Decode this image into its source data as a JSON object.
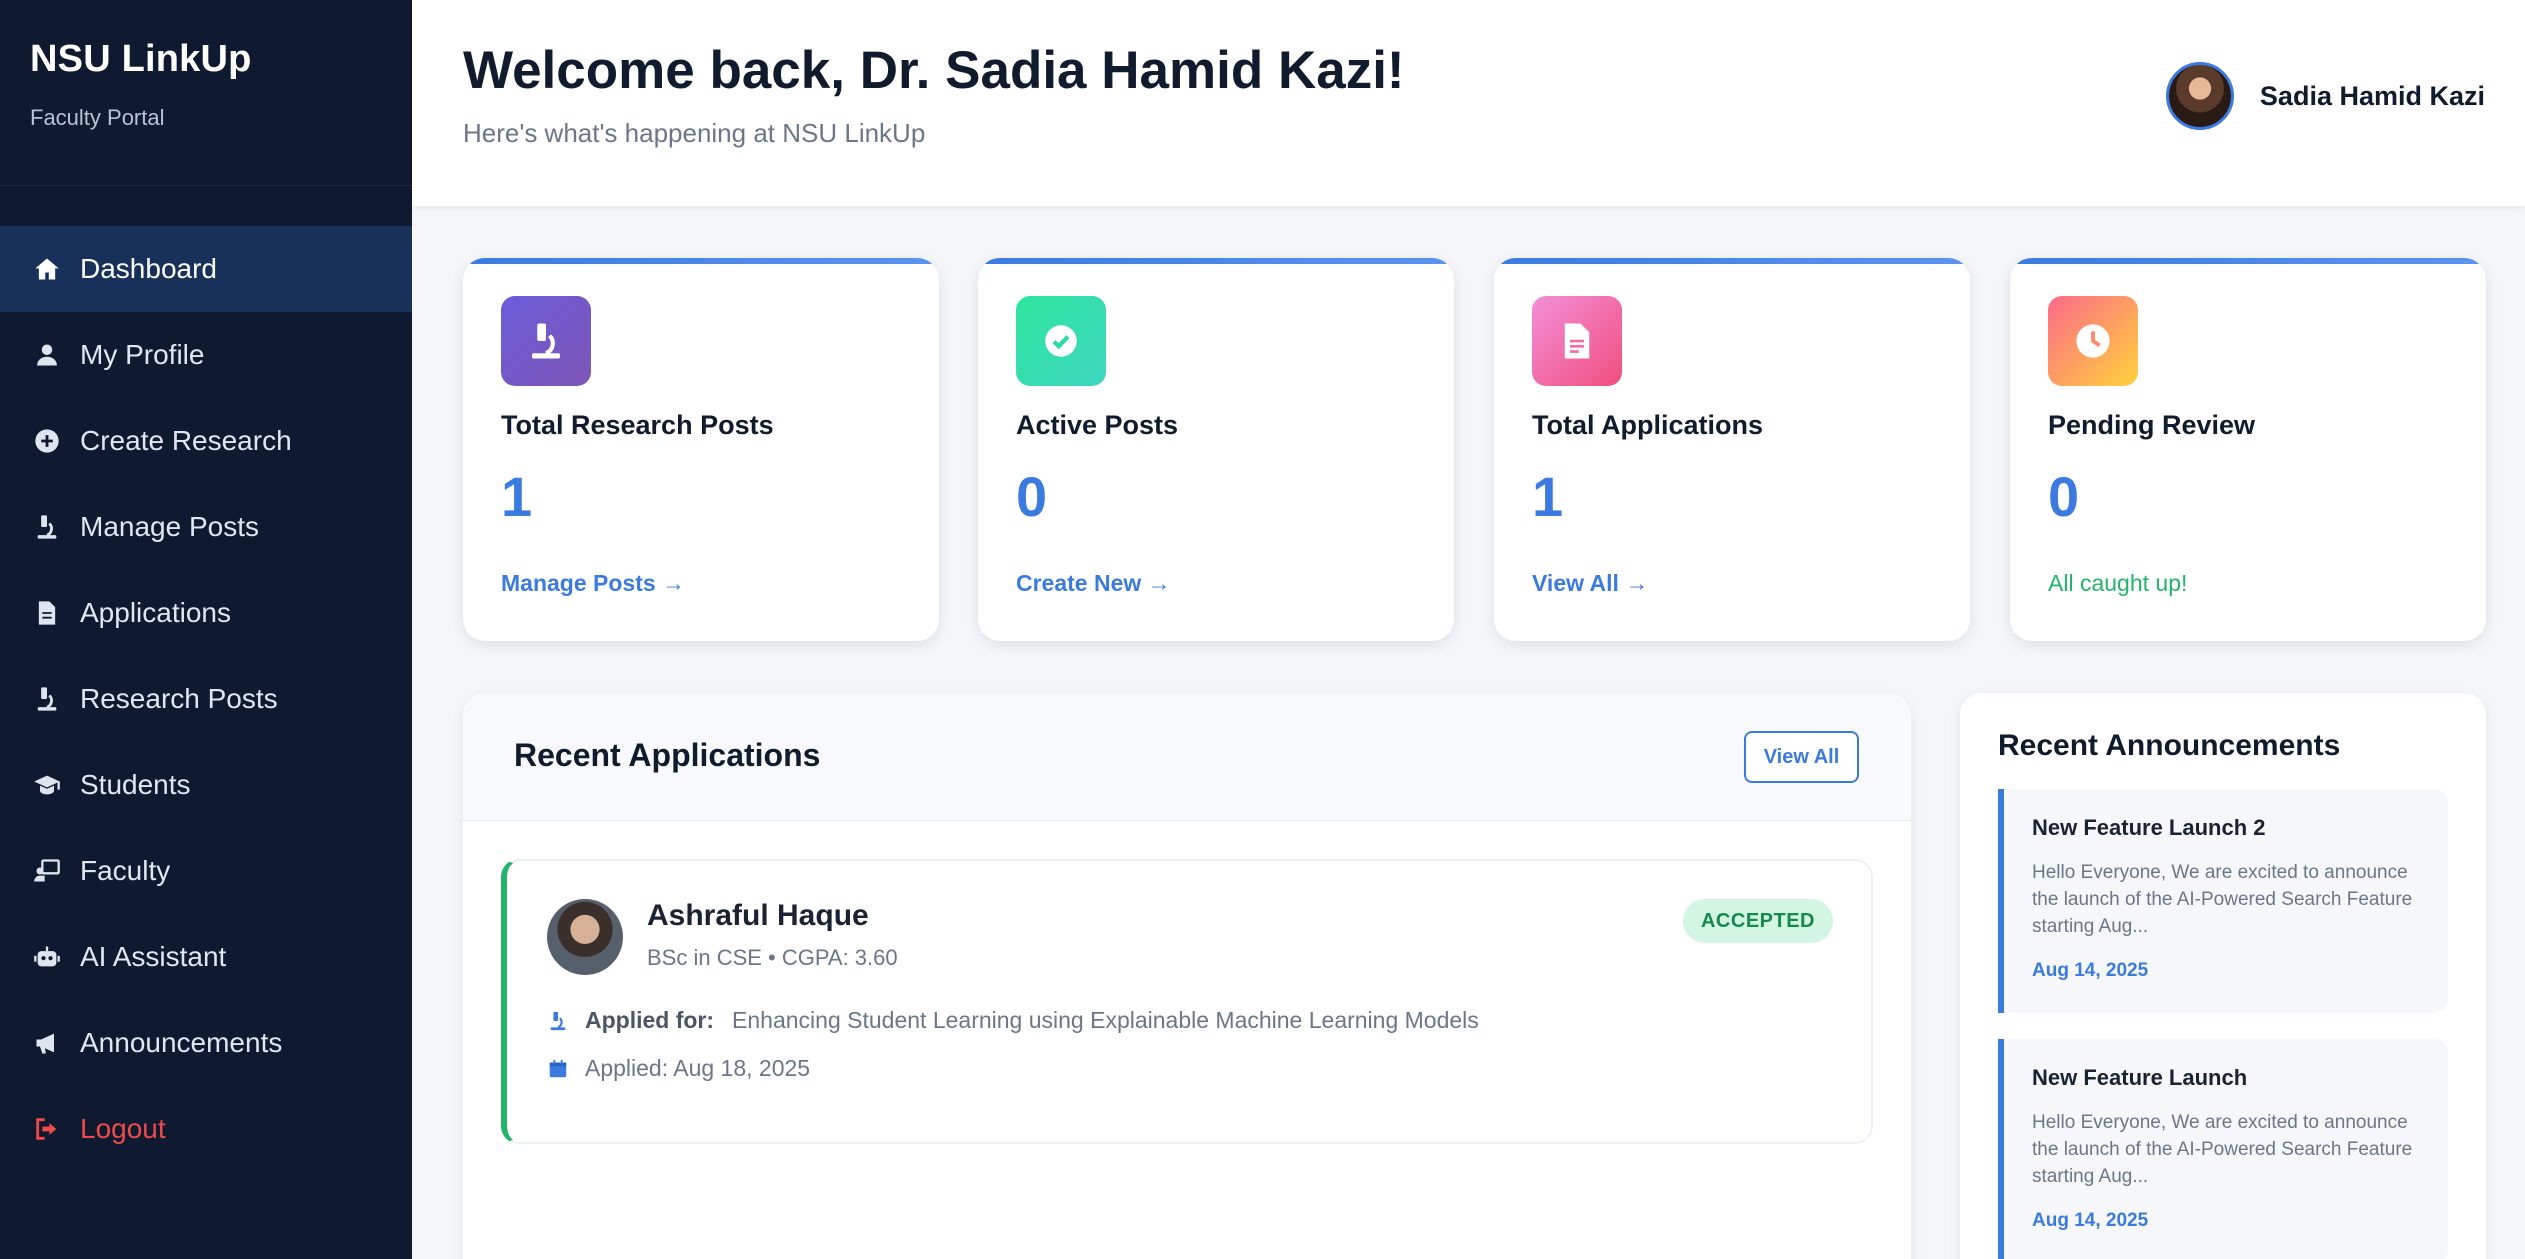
{
  "sidebar": {
    "brand_title": "NSU LinkUp",
    "brand_sub": "Faculty Portal",
    "items": [
      {
        "label": "Dashboard",
        "icon": "home-icon"
      },
      {
        "label": "My Profile",
        "icon": "user-icon"
      },
      {
        "label": "Create Research",
        "icon": "plus-circle-icon"
      },
      {
        "label": "Manage Posts",
        "icon": "microscope-icon"
      },
      {
        "label": "Applications",
        "icon": "document-icon"
      },
      {
        "label": "Research Posts",
        "icon": "microscope-icon"
      },
      {
        "label": "Students",
        "icon": "graduation-cap-icon"
      },
      {
        "label": "Faculty",
        "icon": "teacher-icon"
      },
      {
        "label": "AI Assistant",
        "icon": "robot-icon"
      },
      {
        "label": "Announcements",
        "icon": "megaphone-icon"
      },
      {
        "label": "Logout",
        "icon": "logout-icon"
      }
    ]
  },
  "header": {
    "welcome": "Welcome back, Dr. Sadia Hamid Kazi!",
    "subtitle": "Here's what's happening at NSU LinkUp",
    "user_name": "Sadia Hamid Kazi"
  },
  "stats": [
    {
      "label": "Total Research Posts",
      "value": "1",
      "link": "Manage Posts →",
      "icon": "microscope-icon",
      "color_from": "#6a5cd8",
      "color_to": "#7e55b7"
    },
    {
      "label": "Active Posts",
      "value": "0",
      "link": "Create New →",
      "icon": "check-circle-icon",
      "color_from": "#2ee59d",
      "color_to": "#3ed6c0"
    },
    {
      "label": "Total Applications",
      "value": "1",
      "link": "View All →",
      "icon": "document-icon",
      "color_from": "#f38fd8",
      "color_to": "#f04e7d"
    },
    {
      "label": "Pending Review",
      "value": "0",
      "link": "All caught up!",
      "icon": "clock-icon",
      "color_from": "#fb6a8a",
      "color_to": "#fed23a"
    }
  ],
  "recent_apps": {
    "title": "Recent Applications",
    "view_all": "View All",
    "items": [
      {
        "name": "Ashraful Haque",
        "meta": "BSc in CSE • CGPA: 3.60",
        "status": "ACCEPTED",
        "applied_for_label": "Applied for:",
        "applied_for": "Enhancing Student Learning using Explainable Machine Learning Models",
        "applied_date": "Applied: Aug 18, 2025"
      }
    ]
  },
  "announcements": {
    "title": "Recent Announcements",
    "items": [
      {
        "title": "New Feature Launch 2",
        "body": "Hello Everyone, We are excited to announce the launch of the AI-Powered Search Feature starting Aug...",
        "date": "Aug 14, 2025"
      },
      {
        "title": "New Feature Launch",
        "body": "Hello Everyone, We are excited to announce the launch of the AI-Powered Search Feature starting Aug...",
        "date": "Aug 14, 2025"
      }
    ]
  },
  "colors": {
    "accent": "#3b7be0",
    "sidebar_bg": "#0f1a30",
    "sidebar_active": "#18315a",
    "success": "#22b468",
    "danger": "#ef4a4a"
  }
}
